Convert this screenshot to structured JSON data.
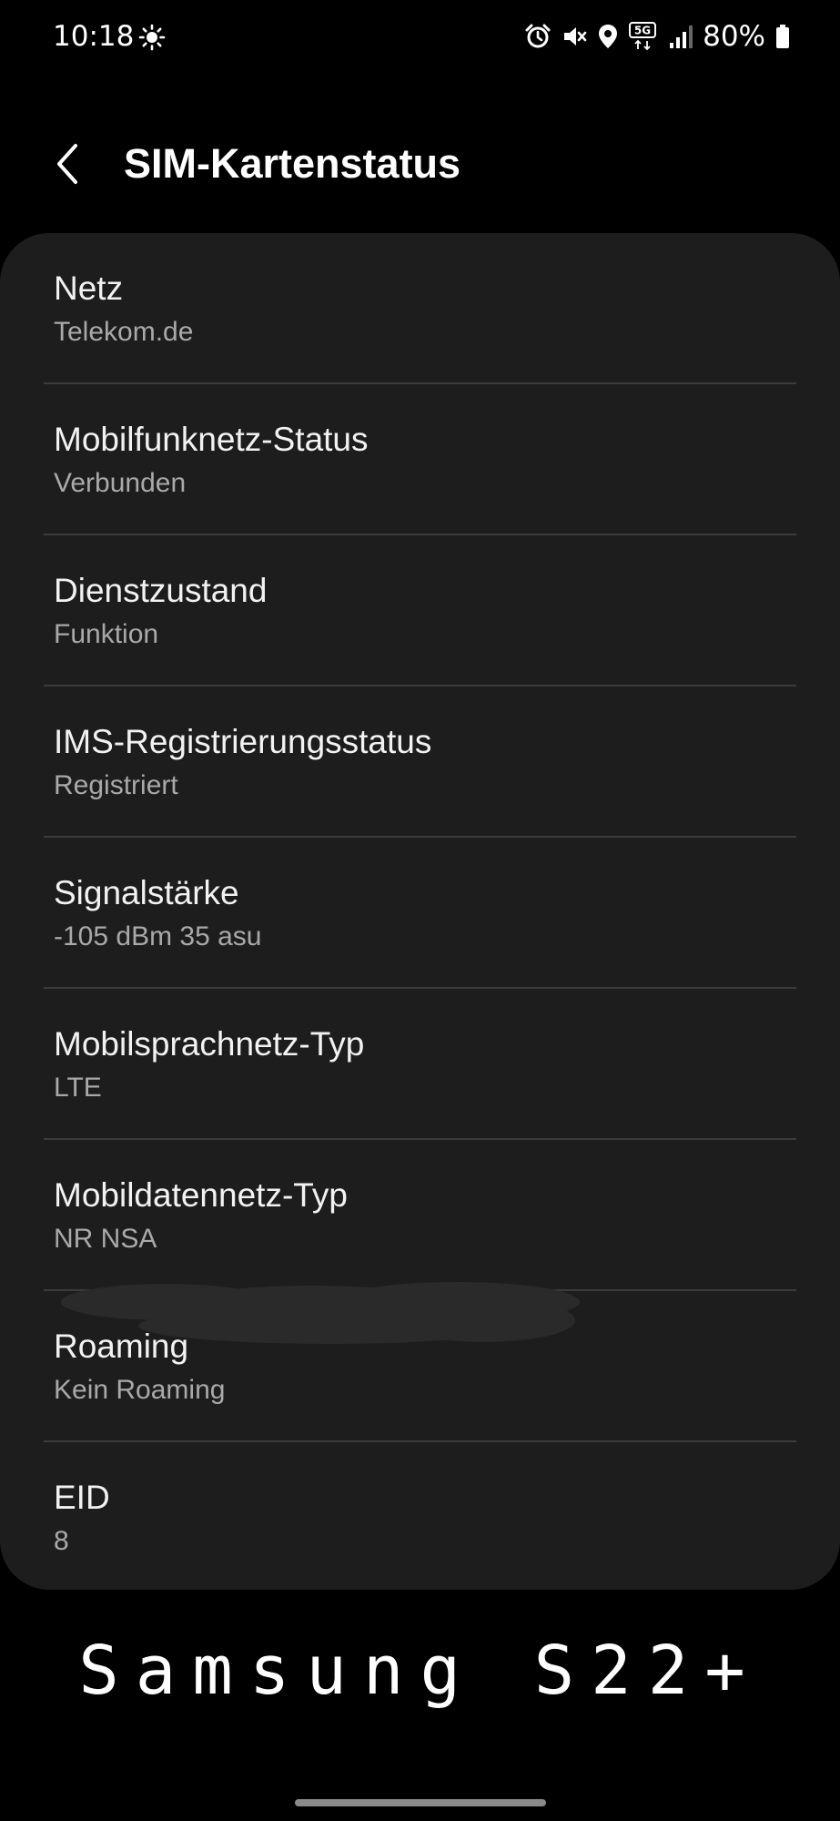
{
  "status_bar": {
    "time": "10:18",
    "left_icon": "brightness-icon",
    "right_icons": [
      "alarm-icon",
      "vibrate-mute-icon",
      "location-icon",
      "5g-icon",
      "signal-icon",
      "battery-icon"
    ],
    "battery_percent_text": "80%"
  },
  "header": {
    "title": "SIM-Kartenstatus"
  },
  "items": [
    {
      "title": "Netz",
      "value": "Telekom.de"
    },
    {
      "title": "Mobilfunknetz-Status",
      "value": "Verbunden"
    },
    {
      "title": "Dienstzustand",
      "value": "Funktion"
    },
    {
      "title": "IMS-Registrierungsstatus",
      "value": "Registriert"
    },
    {
      "title": "Signalstärke",
      "value": "-105 dBm 35 asu"
    },
    {
      "title": "Mobilsprachnetz-Typ",
      "value": "LTE"
    },
    {
      "title": "Mobildatennetz-Typ",
      "value": "NR NSA"
    },
    {
      "title": "Roaming",
      "value": "Kein Roaming"
    },
    {
      "title": "EID",
      "value": "8"
    }
  ],
  "caption": "Samsung S22+",
  "colors": {
    "background": "#000000",
    "card": "#1d1d1d",
    "title_text": "#f2f2f2",
    "value_text": "#a9a9a9",
    "divider": "#3b3b3b"
  }
}
